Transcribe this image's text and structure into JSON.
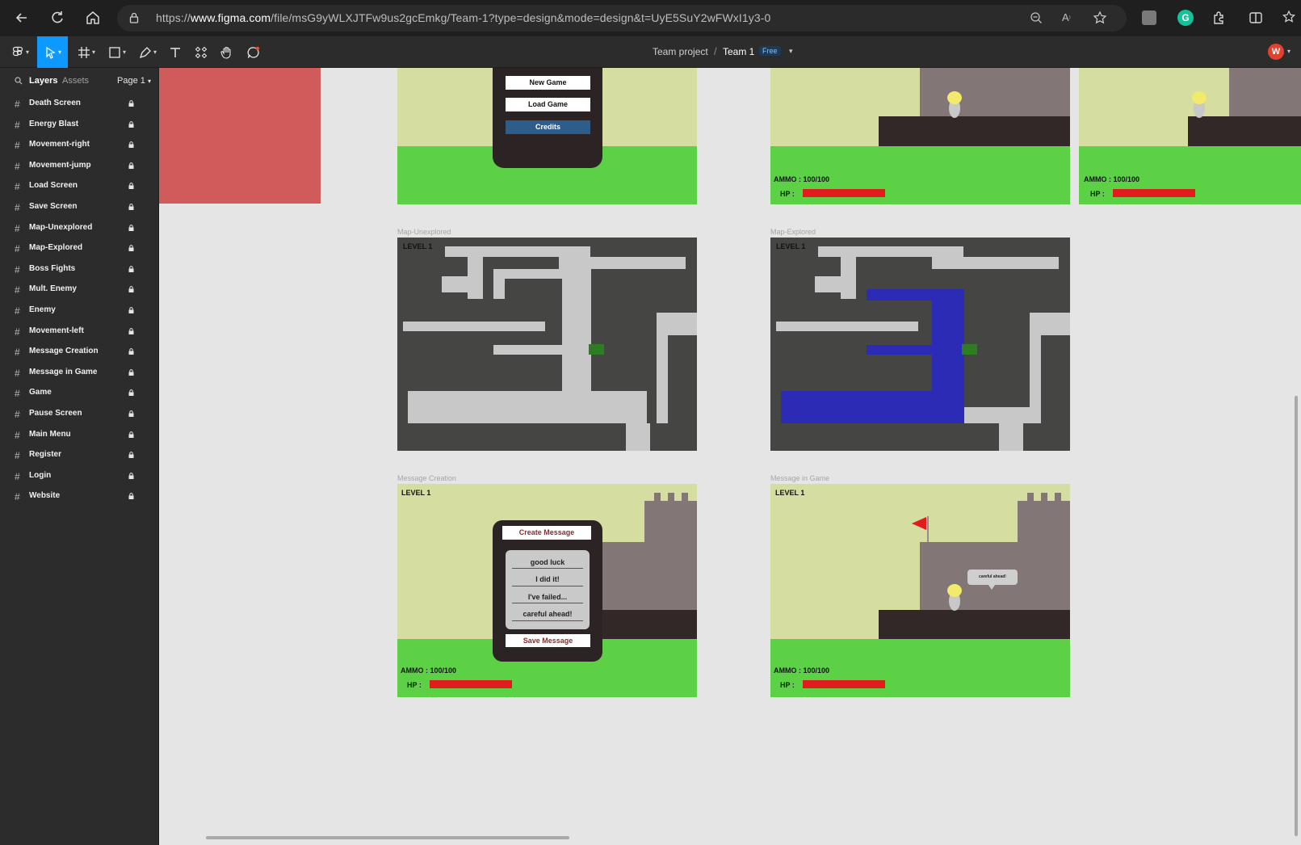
{
  "browser": {
    "url_prefix": "https://",
    "url_host": "www.figma.com",
    "url_path": "/file/msG9yWLXJTFw9us2gcEmkg/Team-1?type=design&mode=design&t=UyE5SuY2wFWxI1y3-0"
  },
  "toolbar": {
    "project": "Team project",
    "separator": "/",
    "file": "Team 1",
    "badge": "Free",
    "avatar_initial": "W",
    "accent": "#0d99ff"
  },
  "left_panel": {
    "tab_layers": "Layers",
    "tab_assets": "Assets",
    "page": "Page 1",
    "layers": [
      {
        "name": "Death Screen"
      },
      {
        "name": "Energy Blast"
      },
      {
        "name": "Movement-right"
      },
      {
        "name": "Movement-jump"
      },
      {
        "name": "Load Screen"
      },
      {
        "name": "Save Screen"
      },
      {
        "name": "Map-Unexplored"
      },
      {
        "name": "Map-Explored"
      },
      {
        "name": "Boss Fights"
      },
      {
        "name": "Mult. Enemy"
      },
      {
        "name": "Enemy"
      },
      {
        "name": "Movement-left"
      },
      {
        "name": "Message Creation"
      },
      {
        "name": "Message in Game"
      },
      {
        "name": "Game"
      },
      {
        "name": "Pause Screen"
      },
      {
        "name": "Main Menu"
      },
      {
        "name": "Register"
      },
      {
        "name": "Login"
      },
      {
        "name": "Website"
      }
    ]
  },
  "canvas": {
    "menu_frame": {
      "new_game": "New Game",
      "load_game": "Load Game",
      "credits": "Credits"
    },
    "top_frame_a": {
      "ammo": "AMMO : 100/100",
      "hp": "HP :"
    },
    "top_frame_b": {
      "ammo": "AMMO : 100/100",
      "hp": "HP :"
    },
    "map_unexplored": {
      "label": "Map-Unexplored",
      "level": "LEVEL 1"
    },
    "map_explored": {
      "label": "Map-Explored",
      "level": "LEVEL 1"
    },
    "message_creation": {
      "label": "Message Creation",
      "level": "LEVEL 1",
      "create_button": "Create Message",
      "messages": [
        "good luck",
        "I did it!",
        "I've failed...",
        "careful ahead!"
      ],
      "save_button": "Save Message",
      "ammo": "AMMO : 100/100",
      "hp": "HP :"
    },
    "message_in_game": {
      "label": "Message in Game",
      "level": "LEVEL 1",
      "bubble": "careful ahead!",
      "ammo": "AMMO : 100/100",
      "hp": "HP :"
    }
  },
  "colors": {
    "sky": "#d6dda0",
    "grass": "#5cd146",
    "hp": "#e01c1c",
    "maze_bg": "#454543",
    "explored": "#2b2bb5",
    "credits_btn": "#2e5d8c",
    "menu_btn_text": "#8a2b2b"
  }
}
